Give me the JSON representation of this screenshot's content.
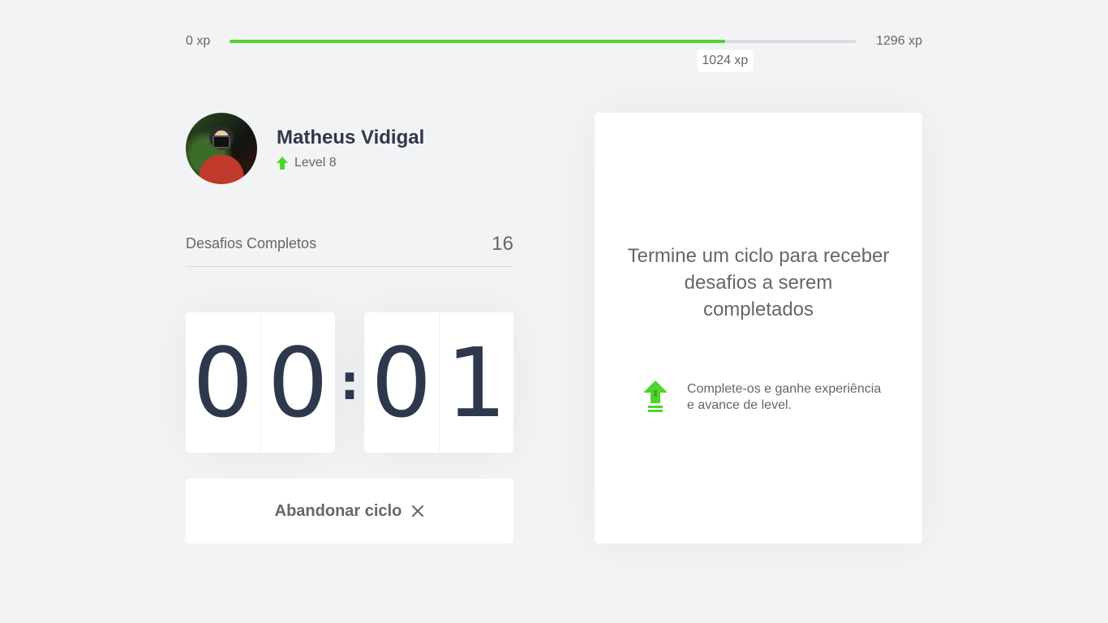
{
  "experience": {
    "min_label": "0 xp",
    "max_label": "1296 xp",
    "current_label": "1024 xp",
    "current": 1024,
    "max": 1296,
    "progress_color": "#4cd62b"
  },
  "profile": {
    "name": "Matheus Vidigal",
    "level_label": "Level 8",
    "level_icon": "level-up-arrow-icon"
  },
  "challenges": {
    "label": "Desafios Completos",
    "count": "16"
  },
  "countdown": {
    "minute_tens": "0",
    "minute_ones": "0",
    "separator": ":",
    "second_tens": "0",
    "second_ones": "1"
  },
  "abandon_button": {
    "label": "Abandonar ciclo",
    "icon": "close-icon"
  },
  "challenge_box": {
    "title": "Termine um ciclo para receber desafios a serem completados",
    "hint": "Complete-os e ganhe experiência e avance de level.",
    "hint_icon": "level-up-icon"
  },
  "colors": {
    "accent_green": "#4cd62b",
    "title_text": "#2e384d",
    "body_text": "#666666",
    "background": "#f2f3f5"
  }
}
